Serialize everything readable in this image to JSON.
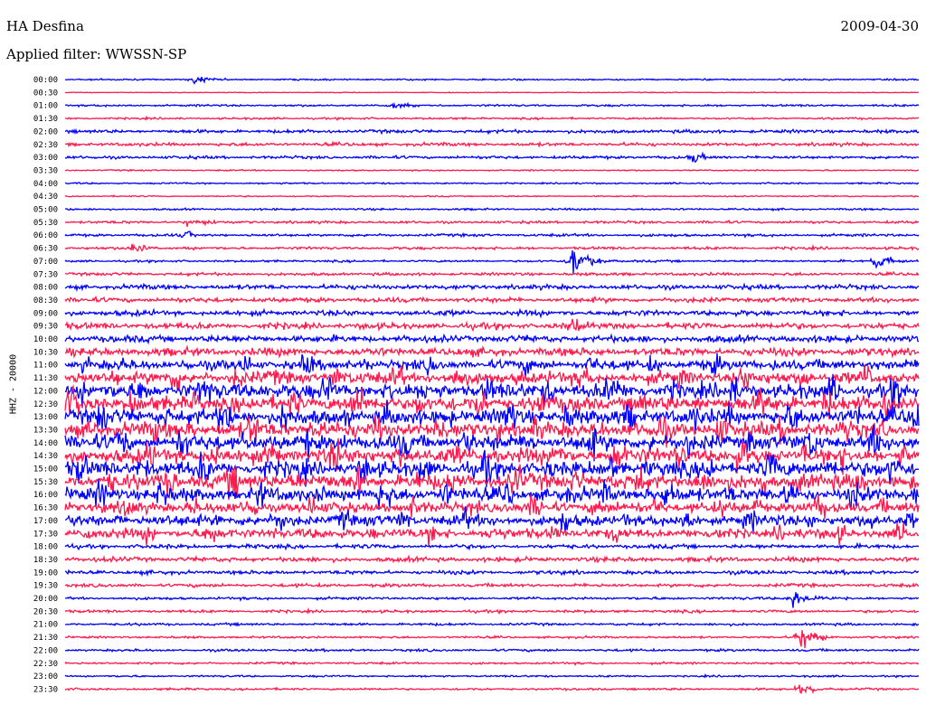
{
  "header": {
    "station": "HA Desfina",
    "date": "2009-04-30",
    "filter_label": "Applied filter: WWSSN-SP"
  },
  "channel_label": "HHZ - 20000",
  "colors": {
    "trace_a": "#0000ff",
    "trace_b": "#ff1a4d",
    "background": "#ffffff",
    "text": "#000000"
  },
  "chart_data": {
    "type": "helicorder",
    "row_interval_minutes": 30,
    "row_labels": [
      "00:00",
      "00:30",
      "01:00",
      "01:30",
      "02:00",
      "02:30",
      "03:00",
      "03:30",
      "04:00",
      "04:30",
      "05:00",
      "05:30",
      "06:00",
      "06:30",
      "07:00",
      "07:30",
      "08:00",
      "08:30",
      "09:00",
      "09:30",
      "10:00",
      "10:30",
      "11:00",
      "11:30",
      "12:00",
      "12:30",
      "13:00",
      "13:30",
      "14:00",
      "14:30",
      "15:00",
      "15:30",
      "16:00",
      "16:30",
      "17:00",
      "17:30",
      "18:00",
      "18:30",
      "19:00",
      "19:30",
      "20:00",
      "20:30",
      "21:00",
      "21:30",
      "22:00",
      "22:30",
      "23:00",
      "23:30"
    ],
    "series": [
      {
        "color": "#0000ff",
        "rows": "even"
      },
      {
        "color": "#ff1a4d",
        "rows": "odd"
      }
    ],
    "row_activity": [
      1.2,
      0.6,
      1.5,
      1.5,
      2.5,
      2.5,
      2.2,
      1.0,
      1.2,
      1.0,
      1.4,
      2.0,
      2.0,
      2.0,
      1.6,
      2.2,
      3.5,
      3.5,
      4.0,
      4.5,
      5.0,
      6.0,
      7.0,
      9.0,
      11.0,
      11.0,
      11.0,
      11.0,
      11.0,
      11.0,
      11.0,
      11.0,
      10.0,
      8.0,
      8.0,
      7.0,
      3.0,
      3.5,
      2.8,
      2.5,
      2.0,
      2.0,
      1.8,
      1.6,
      1.8,
      1.6,
      1.4,
      1.6
    ],
    "events": [
      {
        "row": 0,
        "minute": 4.5,
        "amplitude": 9
      },
      {
        "row": 2,
        "minute": 11.5,
        "amplitude": 7
      },
      {
        "row": 6,
        "minute": 22,
        "amplitude": 12
      },
      {
        "row": 11,
        "minute": 4.2,
        "amplitude": 8
      },
      {
        "row": 12,
        "minute": 4.2,
        "amplitude": 10
      },
      {
        "row": 13,
        "minute": 2.3,
        "amplitude": 14
      },
      {
        "row": 14,
        "minute": 17.8,
        "amplitude": 40
      },
      {
        "row": 14,
        "minute": 28.5,
        "amplitude": 20
      },
      {
        "row": 19,
        "minute": 17.8,
        "amplitude": 22
      },
      {
        "row": 40,
        "minute": 25.5,
        "amplitude": 20
      },
      {
        "row": 43,
        "minute": 25.8,
        "amplitude": 28
      },
      {
        "row": 47,
        "minute": 25.8,
        "amplitude": 14
      }
    ]
  }
}
